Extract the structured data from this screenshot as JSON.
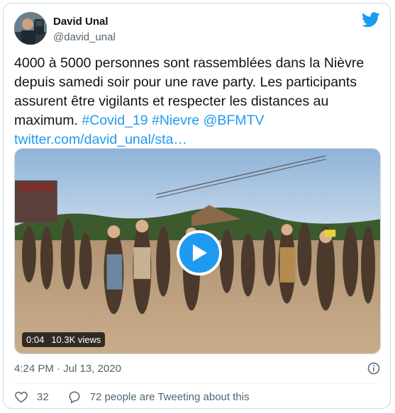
{
  "author": {
    "name": "David Unal",
    "handle": "@david_unal"
  },
  "tweet": {
    "text_plain": "4000 à 5000 personnes sont rassemblées dans la Nièvre depuis samedi soir pour une rave party. Les participants assurent être vigilants et respecter les distances au maximum.",
    "hashtag1": "#Covid_19",
    "hashtag2": "#Nievre",
    "mention": "@BFMTV",
    "link": "twitter.com/david_unal/sta…"
  },
  "video": {
    "duration": "0:04",
    "views": "10.3K views"
  },
  "meta": {
    "timestamp": "4:24 PM · Jul 13, 2020"
  },
  "actions": {
    "likes": "32",
    "retweets": "72 people are Tweeting about this"
  },
  "colors": {
    "accent": "#1d9bf0",
    "text": "#0f1419",
    "muted": "#536471"
  },
  "icons": [
    "twitter-bird-icon",
    "play-icon",
    "info-icon",
    "heart-icon",
    "comment-bubble-icon"
  ]
}
